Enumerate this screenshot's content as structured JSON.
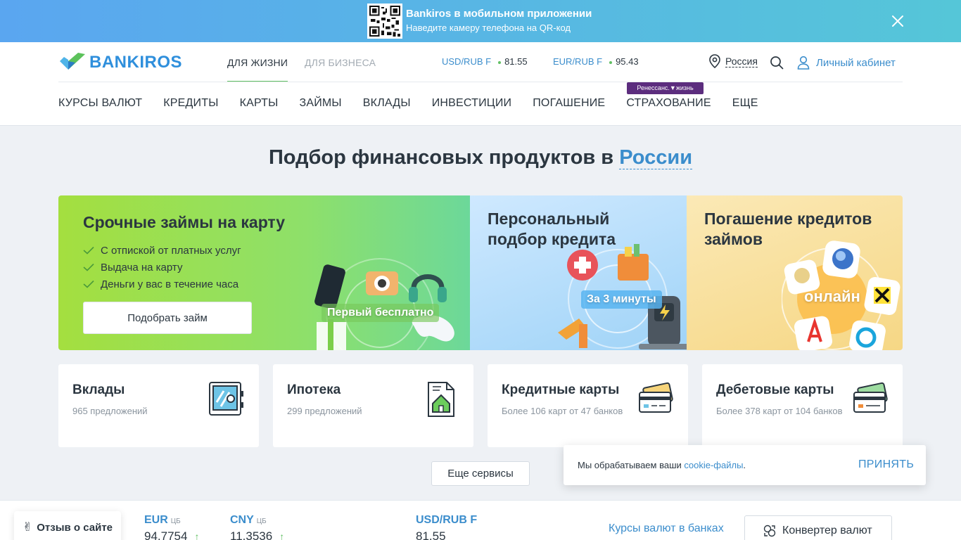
{
  "promo_banner": {
    "title": "Bankiros в мобильном приложении",
    "subtitle": "Наведите камеру телефона на QR-код",
    "icons": [
      "qr-code-icon",
      "close-icon"
    ]
  },
  "header": {
    "logo_text": "BANKIROS",
    "segments": [
      "ДЛЯ ЖИЗНИ",
      "ДЛЯ БИЗНЕСА"
    ],
    "rates": [
      {
        "label": "USD/RUB F",
        "value": "81.55"
      },
      {
        "label": "EUR/RUB F",
        "value": "95.43"
      }
    ],
    "region": "Россия",
    "cabinet": "Личный кабинет",
    "nav": [
      "КУРСЫ ВАЛЮТ",
      "КРЕДИТЫ",
      "КАРТЫ",
      "ЗАЙМЫ",
      "ВКЛАДЫ",
      "ИНВЕСТИЦИИ",
      "ПОГАШЕНИЕ",
      "СТРАХОВАНИЕ",
      "ЕЩЕ"
    ],
    "insurance_badge": "Ренессанс.▼жизнь"
  },
  "hero": {
    "title": "Подбор финансовых продуктов в",
    "region": "России"
  },
  "promo_cards": {
    "loans": {
      "title": "Срочные займы на карту",
      "features": [
        "С отпиской от платных услуг",
        "Выдача на карту",
        "Деньги у вас в течение часа"
      ],
      "button": "Подобрать займ",
      "art_label": "Первый бесплатно"
    },
    "credit": {
      "title_line1": "Персональный",
      "title_line2": "подбор кредита",
      "art_label": "За 3 минуты"
    },
    "repay": {
      "title_line1": "Погашение кредитов",
      "title_line2": "займов",
      "art_label": "онлайн"
    }
  },
  "tiles": [
    {
      "title": "Вклады",
      "subtitle": "965 предложений",
      "icon": "safe-icon"
    },
    {
      "title": "Ипотека",
      "subtitle": "299 предложений",
      "icon": "house-document-icon"
    },
    {
      "title": "Кредитные карты",
      "subtitle": "Более 106 карт от 47 банков",
      "icon": "credit-card-icon"
    },
    {
      "title": "Дебетовые карты",
      "subtitle": "Более 378 карт от 104 банков",
      "icon": "debit-card-icon"
    }
  ],
  "more_services": "Еще сервисы",
  "feedback": {
    "emoji": "✌",
    "label": "Отзыв о сайте"
  },
  "currencies": [
    {
      "code": "EUR",
      "source": "ЦБ",
      "value": "94.7754",
      "trend": "↑"
    },
    {
      "code": "CNY",
      "source": "ЦБ",
      "value": "11.3536",
      "trend": "↑"
    },
    {
      "code": "USD/RUB F",
      "source": "",
      "value": "81.55",
      "trend": ""
    }
  ],
  "bank_rates_link": "Курсы валют в банках",
  "converter_button": "Конвертер валют",
  "cookie": {
    "text": "Мы обрабатываем ваши",
    "link": "cookie-файлы",
    "dot": ".",
    "accept": "ПРИНЯТЬ"
  },
  "colors": {
    "accent_blue": "#3b8dcc",
    "accent_green": "#62c064",
    "text": "#2b3640",
    "banner_start": "#5aa6f0",
    "banner_end": "#55c6d8"
  }
}
